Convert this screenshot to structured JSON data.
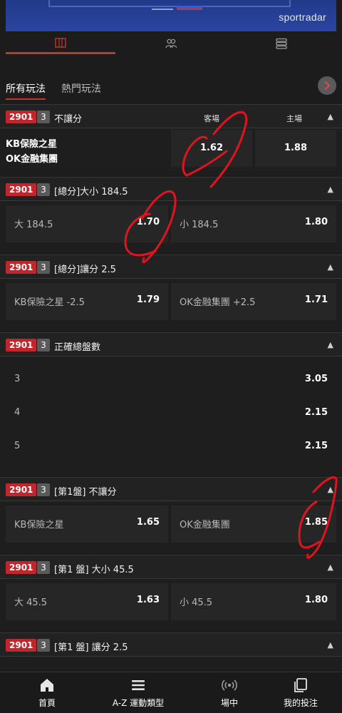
{
  "banner": {
    "brand": "sportradar"
  },
  "icon_tabs": [
    {
      "name": "scoreboard",
      "icon": "scoreboard-icon"
    },
    {
      "name": "players",
      "icon": "players-icon"
    },
    {
      "name": "list",
      "icon": "list-icon"
    }
  ],
  "bet_tabs": {
    "all": "所有玩法",
    "popular": "熱門玩法"
  },
  "markets": {
    "m1": {
      "id": "2901",
      "n": "3",
      "title": "不讓分",
      "col_away": "客場",
      "col_home": "主場",
      "team1": "KB保險之星",
      "team2": "OK金融集團",
      "away_odds": "1.62",
      "home_odds": "1.88"
    },
    "m2": {
      "id": "2901",
      "n": "3",
      "title": "[總分]大小 184.5",
      "left_label": "大 184.5",
      "left_odds": "1.70",
      "right_label": "小 184.5",
      "right_odds": "1.80"
    },
    "m3": {
      "id": "2901",
      "n": "3",
      "title": "[總分]讓分 2.5",
      "left_label": "KB保險之星 -2.5",
      "left_odds": "1.79",
      "right_label": "OK金融集團 +2.5",
      "right_odds": "1.71"
    },
    "m4": {
      "id": "2901",
      "n": "3",
      "title": "正確總盤數",
      "rows": [
        {
          "label": "3",
          "odds": "3.05"
        },
        {
          "label": "4",
          "odds": "2.15"
        },
        {
          "label": "5",
          "odds": "2.15"
        }
      ]
    },
    "m5": {
      "id": "2901",
      "n": "3",
      "title": "[第1盤] 不讓分",
      "left_label": "KB保險之星",
      "left_odds": "1.65",
      "right_label": "OK金融集團",
      "right_odds": "1.85"
    },
    "m6": {
      "id": "2901",
      "n": "3",
      "title": "[第1 盤] 大小 45.5",
      "left_label": "大 45.5",
      "left_odds": "1.63",
      "right_label": "小 45.5",
      "right_odds": "1.80"
    },
    "m7": {
      "id": "2901",
      "n": "3",
      "title": "[第1 盤] 讓分 2.5"
    }
  },
  "bottom_nav": {
    "home": "首頁",
    "sports": "A-Z 運動類型",
    "live": "場中",
    "my_bets": "我的投注"
  },
  "colors": {
    "accent": "#c0272d",
    "background": "#1c1c1c",
    "annotation": "#e0141e"
  }
}
